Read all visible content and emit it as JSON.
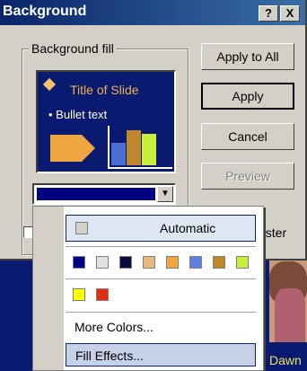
{
  "dialog": {
    "title": "Background",
    "help_btn": "?",
    "close_btn": "X",
    "group_label": "Background fill",
    "buttons": {
      "apply_all": "Apply to All",
      "apply": "Apply",
      "cancel": "Cancel",
      "preview": "Preview"
    },
    "master_label_fragment": "aster"
  },
  "preview": {
    "title": "Title of Slide",
    "bullet": "• Bullet text",
    "bars": [
      {
        "value": 0.55,
        "color": "#4a6fd0"
      },
      {
        "value": 0.85,
        "color": "#c0862a"
      },
      {
        "value": 0.75,
        "color": "#c8ef3a"
      }
    ]
  },
  "combo": {
    "selected_color": "#000080",
    "arrow": "▼"
  },
  "menu": {
    "automatic": "Automatic",
    "row1_colors": [
      "#000080",
      "#e0e0e0",
      "#0a0a40",
      "#e4b880",
      "#f0a640",
      "#6080e0",
      "#c0862a",
      "#c8ef3a"
    ],
    "row2_colors": [
      "#ffff00",
      "#e03010"
    ],
    "more_colors": "More Colors...",
    "fill_effects": "Fill Effects..."
  },
  "background": {
    "name_fragment": "Dawn"
  }
}
